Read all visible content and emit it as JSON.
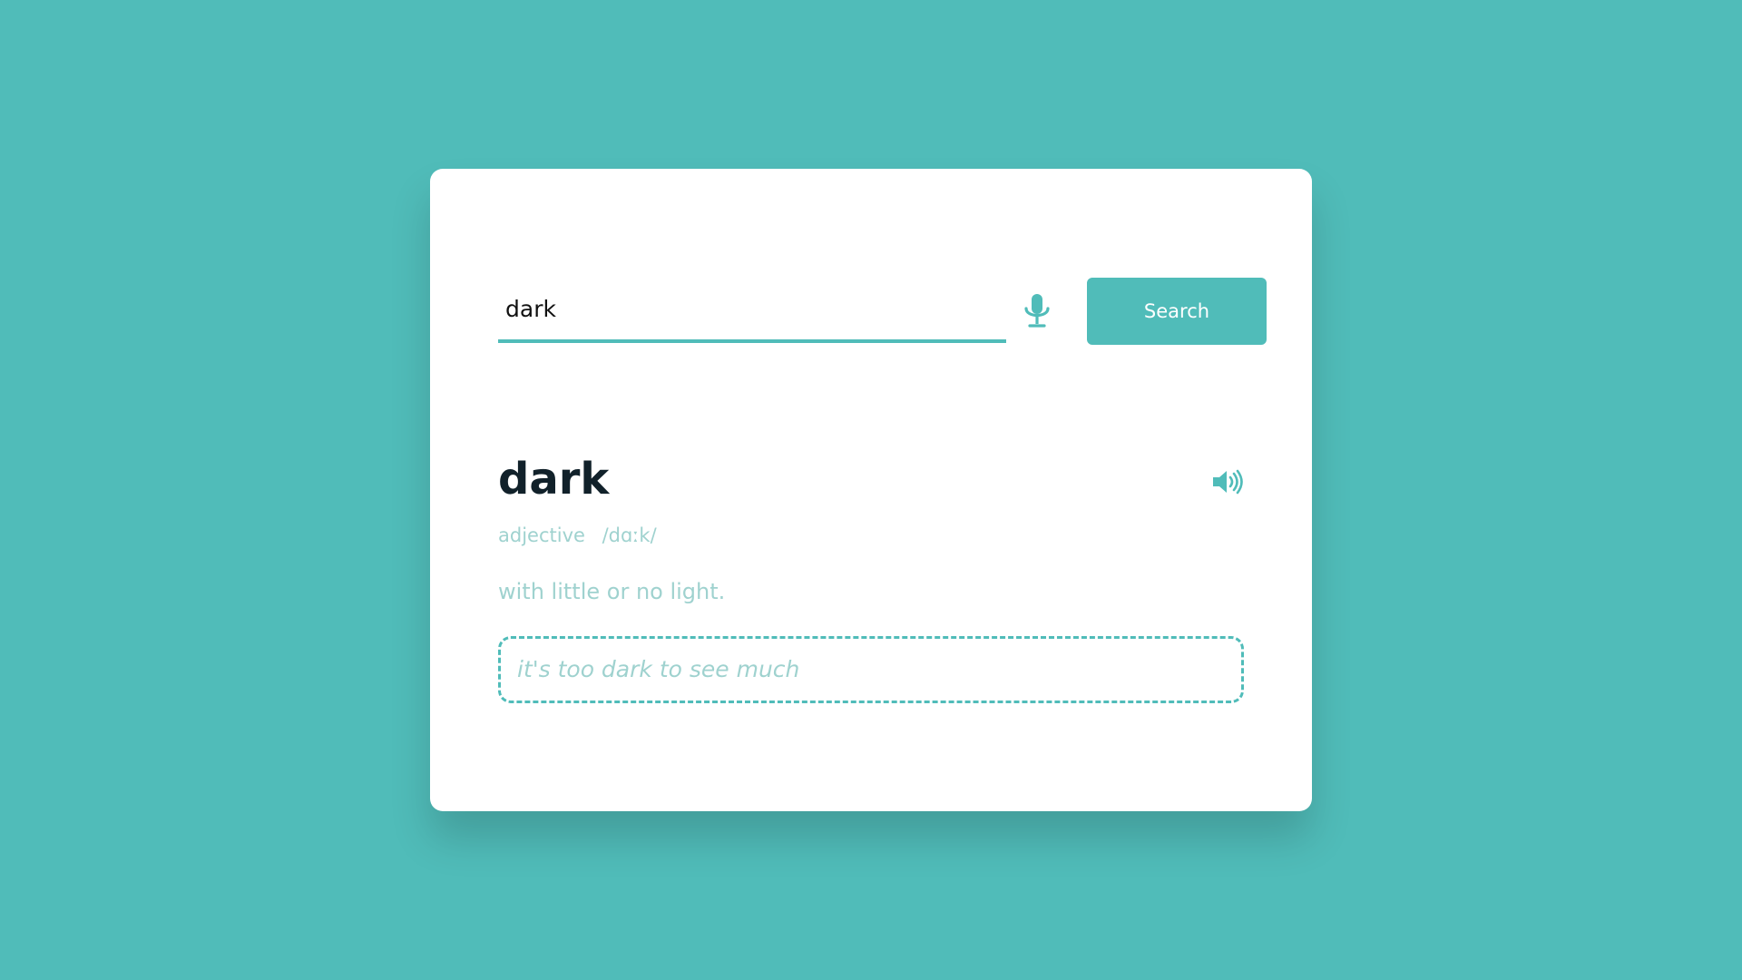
{
  "search": {
    "value": "dark",
    "button_label": "Search",
    "mic_icon": "microphone-icon"
  },
  "result": {
    "word": "dark",
    "part_of_speech": "adjective",
    "phonetic": "/dɑːk/",
    "definition": "with little or no light.",
    "example": "it's too dark to see much",
    "audio_icon": "speaker-volume-icon"
  },
  "colors": {
    "background": "#50bcb9",
    "accent": "#50bcb9",
    "card": "#ffffff",
    "word_text": "#11212a",
    "muted_text": "#9fd2cf"
  }
}
